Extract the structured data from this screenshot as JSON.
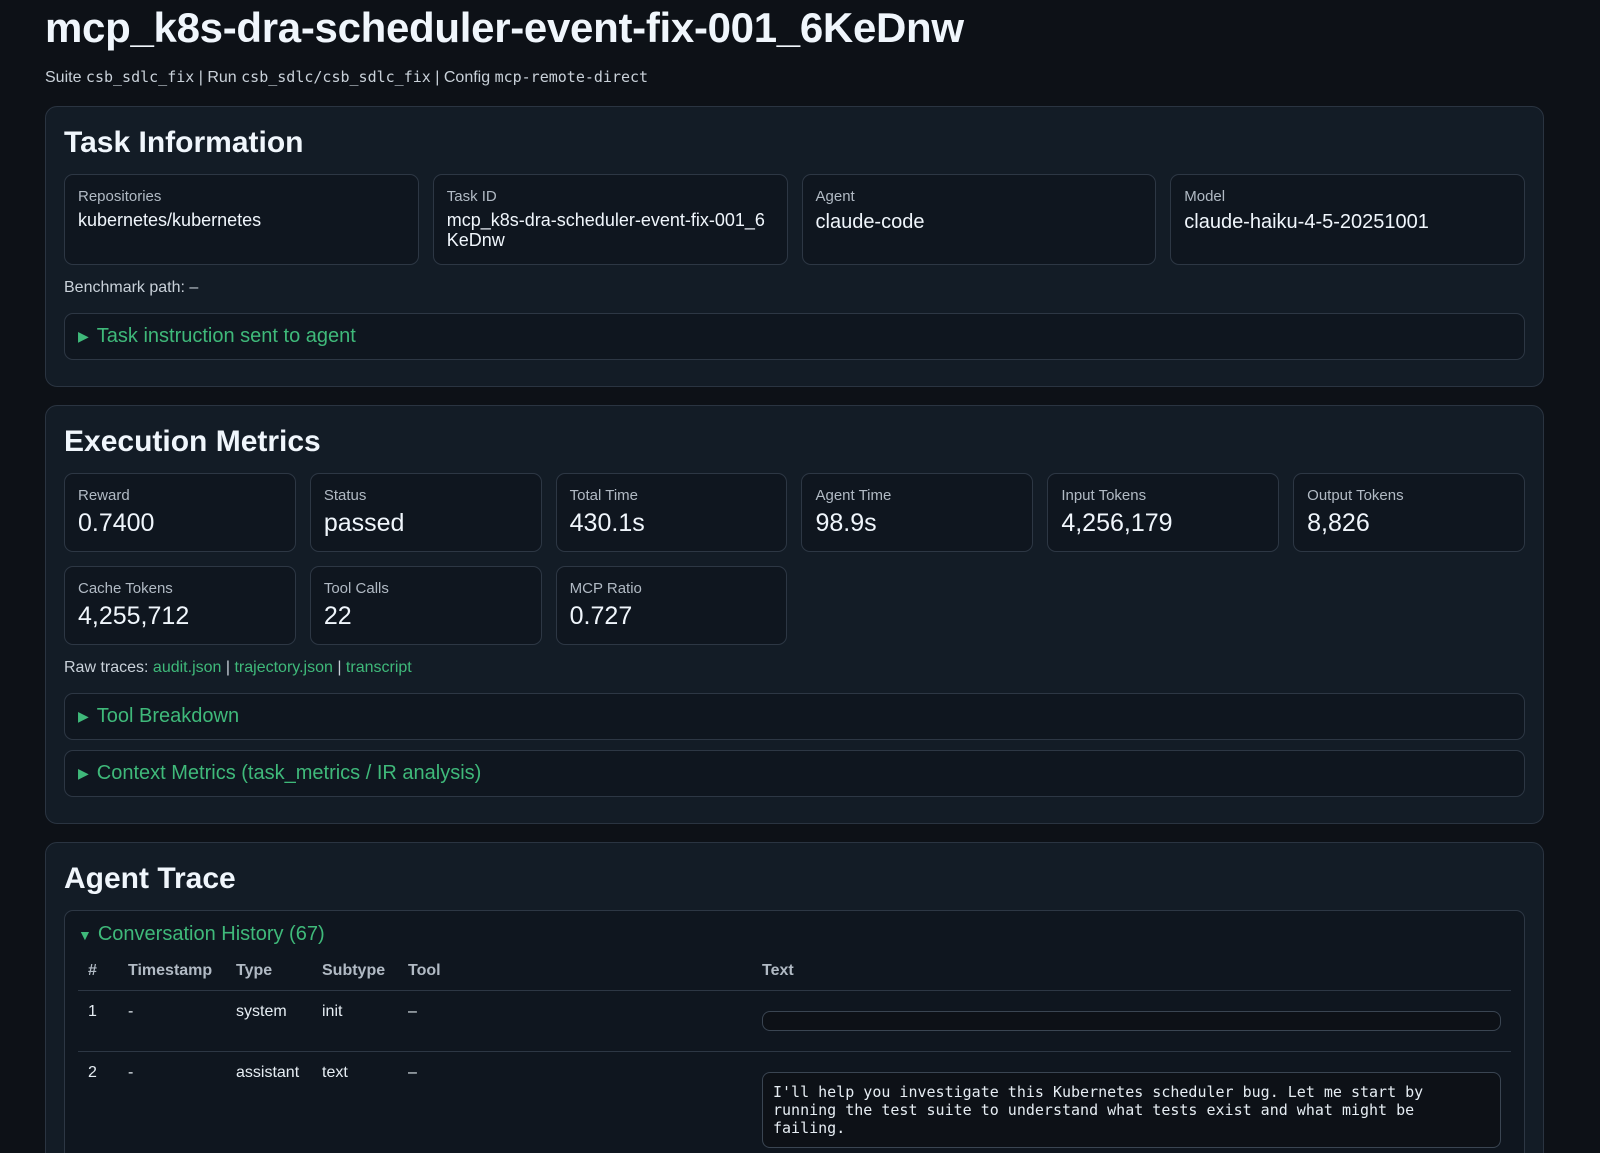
{
  "page": {
    "title": "mcp_k8s-dra-scheduler-event-fix-001_6KeDnw",
    "suite_label": "Suite",
    "suite": "csb_sdlc_fix",
    "run_label": "Run",
    "run": "csb_sdlc/csb_sdlc_fix",
    "config_label": "Config",
    "config": "mcp-remote-direct"
  },
  "task_info": {
    "heading": "Task Information",
    "cards": [
      {
        "label": "Repositories",
        "value": "kubernetes/kubernetes"
      },
      {
        "label": "Task ID",
        "value": "mcp_k8s-dra-scheduler-event-fix-001_6KeDnw"
      },
      {
        "label": "Agent",
        "value": "claude-code"
      },
      {
        "label": "Model",
        "value": "claude-haiku-4-5-20251001"
      }
    ],
    "benchmark_path": "Benchmark path: –",
    "instruction_toggle": "Task instruction sent to agent"
  },
  "metrics": {
    "heading": "Execution Metrics",
    "cards": [
      {
        "label": "Reward",
        "value": "0.7400"
      },
      {
        "label": "Status",
        "value": "passed"
      },
      {
        "label": "Total Time",
        "value": "430.1s"
      },
      {
        "label": "Agent Time",
        "value": "98.9s"
      },
      {
        "label": "Input Tokens",
        "value": "4,256,179"
      },
      {
        "label": "Output Tokens",
        "value": "8,826"
      },
      {
        "label": "Cache Tokens",
        "value": "4,255,712"
      },
      {
        "label": "Tool Calls",
        "value": "22"
      },
      {
        "label": "MCP Ratio",
        "value": "0.727"
      }
    ],
    "raw_traces_label": "Raw traces:",
    "links": [
      "audit.json",
      "trajectory.json",
      "transcript"
    ],
    "tool_breakdown": "Tool Breakdown",
    "context_metrics": "Context Metrics (task_metrics / IR analysis)"
  },
  "trace": {
    "heading": "Agent Trace",
    "history_toggle": "Conversation History (67)",
    "columns": [
      "#",
      "Timestamp",
      "Type",
      "Subtype",
      "Tool",
      "Text"
    ],
    "rows": [
      {
        "num": "1",
        "timestamp": "-",
        "type": "system",
        "subtype": "init",
        "tool": "–",
        "text": ""
      },
      {
        "num": "2",
        "timestamp": "-",
        "type": "assistant",
        "subtype": "text",
        "tool": "–",
        "text": "I'll help you investigate this Kubernetes scheduler bug. Let me start by running the test suite to understand what tests exist and what might be failing."
      }
    ]
  }
}
